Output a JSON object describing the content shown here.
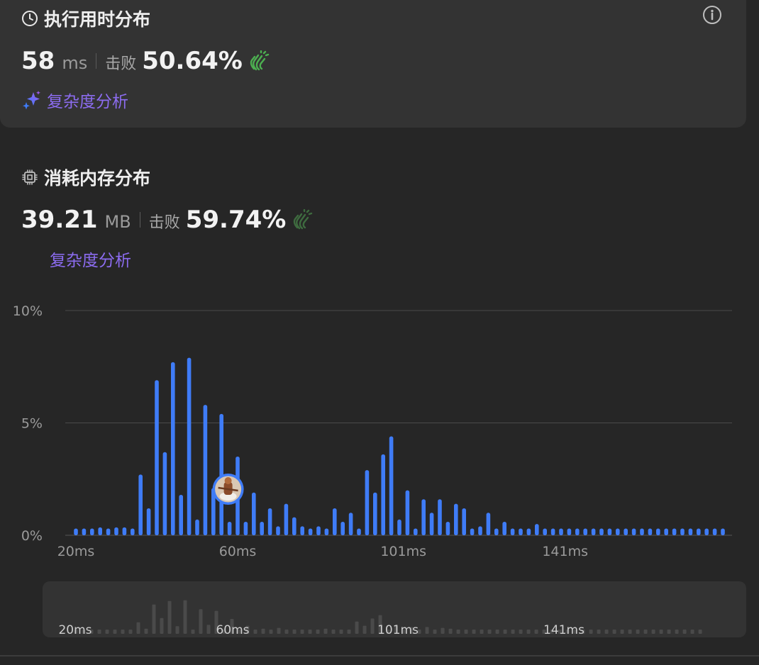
{
  "runtime": {
    "title": "执行用时分布",
    "value": "58",
    "unit": "ms",
    "beat_label": "击败",
    "beat_pct": "50.64%",
    "analysis_label": "复杂度分析"
  },
  "memory": {
    "title": "消耗内存分布",
    "value": "39.21",
    "unit": "MB",
    "beat_label": "击败",
    "beat_pct": "59.74%",
    "analysis_label": "复杂度分析"
  },
  "colors": {
    "bar": "#3f7cf7",
    "bar_mini": "#4a4a4a",
    "clap_active": "#4caf50",
    "clap_dim": "#3e6b3f",
    "analysis": "#8c6cf0"
  },
  "icons": [
    "clock-icon",
    "info-icon",
    "sparkle-icon",
    "chip-icon",
    "clap-icon"
  ],
  "chart_data": {
    "type": "bar",
    "xlabel": "",
    "ylabel": "",
    "y_ticks": [
      "10%",
      "5%",
      "0%"
    ],
    "y_tick_values": [
      10,
      5,
      0
    ],
    "ylim": [
      0,
      10
    ],
    "x_tick_labels": [
      "20ms",
      "60ms",
      "101ms",
      "141ms"
    ],
    "x_tick_values": [
      20,
      60,
      101,
      141
    ],
    "x_start": 20,
    "x_step": 2,
    "grid": true,
    "highlight_x": 58,
    "values": [
      0.3,
      0.3,
      0.3,
      0.35,
      0.3,
      0.35,
      0.35,
      0.3,
      2.7,
      1.2,
      6.9,
      3.7,
      7.7,
      1.8,
      7.9,
      0.7,
      5.8,
      2.1,
      5.4,
      0.6,
      3.5,
      0.6,
      1.9,
      0.6,
      1.2,
      0.4,
      1.4,
      0.8,
      0.4,
      0.3,
      0.4,
      0.3,
      1.2,
      0.6,
      1.0,
      0.3,
      2.9,
      1.9,
      3.6,
      4.4,
      0.7,
      2.0,
      0.3,
      1.6,
      1.0,
      1.6,
      0.6,
      1.4,
      1.2,
      0.3,
      0.4,
      1.0,
      0.3,
      0.6,
      0.3,
      0.3,
      0.3,
      0.5,
      0.3,
      0.3,
      0.3,
      0.3,
      0.3,
      0.3,
      0.3,
      0.3,
      0.3,
      0.3,
      0.3,
      0.3,
      0.3,
      0.3,
      0.3,
      0.3,
      0.3,
      0.3,
      0.3,
      0.3,
      0.3,
      0.3,
      0.3
    ]
  }
}
